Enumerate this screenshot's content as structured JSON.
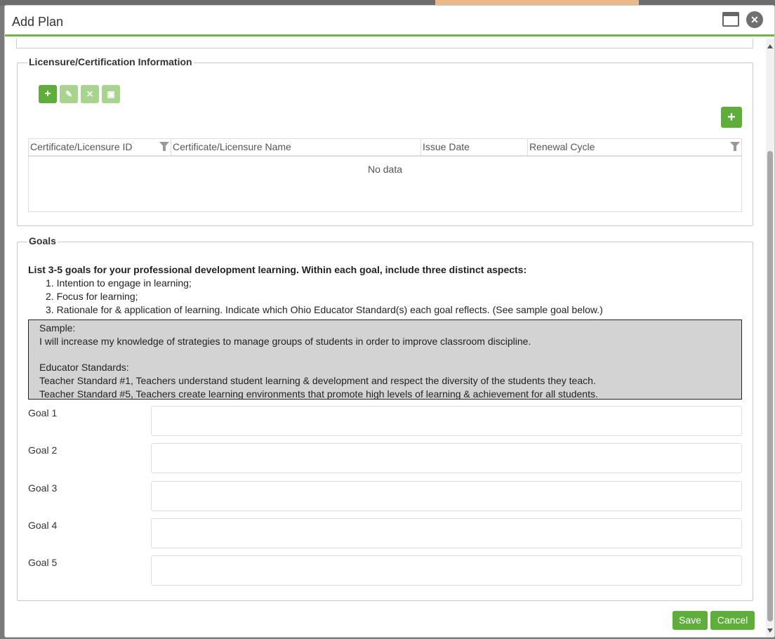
{
  "dialog": {
    "title": "Add Plan",
    "close_glyph": "✕"
  },
  "licensure": {
    "legend": "Licensure/Certification Information",
    "toolbar": {
      "add_glyph": "+",
      "edit_glyph": "✎",
      "delete_glyph": "✕",
      "save_glyph": "▣"
    },
    "add_right_glyph": "+",
    "columns": [
      "Certificate/Licensure ID",
      "Certificate/Licensure Name",
      "Issue Date",
      "Renewal Cycle"
    ],
    "empty_text": "No data"
  },
  "goals": {
    "legend": "Goals",
    "intro": "List 3-5 goals for your professional development learning. Within each goal, include three distinct aspects:",
    "aspects": [
      "1. Intention to engage in learning;",
      "2. Focus for learning;",
      "3. Rationale for & application of learning. Indicate which Ohio Educator Standard(s) each goal reflects. (See sample goal below.)"
    ],
    "sample": {
      "heading": "Sample:",
      "goal_text": "I will increase my knowledge of strategies to manage groups of students in order to improve classroom discipline.",
      "standards_heading": "Educator Standards:",
      "standard_1": "Teacher Standard #1, Teachers understand student learning & development and respect the diversity of the students they teach.",
      "standard_5": "Teacher Standard #5, Teachers create learning environments that promote high levels of learning & achievement for all students."
    },
    "fields": [
      {
        "label": "Goal 1",
        "value": ""
      },
      {
        "label": "Goal 2",
        "value": ""
      },
      {
        "label": "Goal 3",
        "value": ""
      },
      {
        "label": "Goal 4",
        "value": ""
      },
      {
        "label": "Goal 5",
        "value": ""
      }
    ]
  },
  "footer": {
    "save_label": "Save",
    "cancel_label": "Cancel"
  },
  "colors": {
    "accent": "#5fae3c",
    "accent_disabled": "#a9d490",
    "sample_bg": "#d3d3d3"
  }
}
